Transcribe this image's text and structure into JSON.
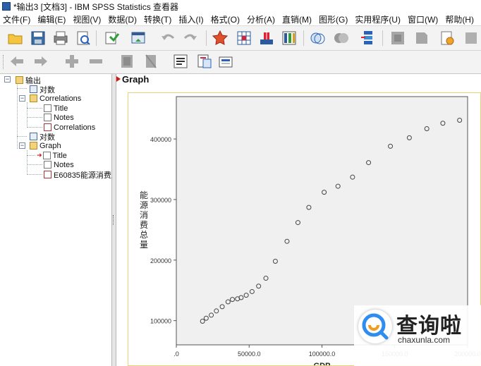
{
  "window": {
    "title": "*输出3 [文档3] - IBM SPSS Statistics 查看器"
  },
  "menu": [
    "文件(F)",
    "编辑(E)",
    "视图(V)",
    "数据(D)",
    "转换(T)",
    "插入(I)",
    "格式(O)",
    "分析(A)",
    "直销(M)",
    "图形(G)",
    "实用程序(U)",
    "窗口(W)",
    "帮助(H)"
  ],
  "toolbar_icons": [
    "open-icon",
    "save-icon",
    "print-icon",
    "print-preview-icon",
    "export-icon",
    "recall-dialog-icon",
    "undo-icon",
    "redo-icon",
    "goto-data-icon",
    "goto-case-icon",
    "goto-variable-icon",
    "variables-icon",
    "select-cases-icon",
    "weight-cases-icon",
    "split-file-icon",
    "value-labels-icon",
    "use-sets-icon",
    "show-all-icon",
    "spelling-icon",
    "scripts-icon",
    "stop-icon"
  ],
  "toolbar2_icons": [
    "back-icon",
    "forward-icon",
    "expand-icon",
    "collapse-icon",
    "show-icon",
    "hide-icon",
    "insert-heading-icon",
    "insert-title-icon",
    "insert-text-icon"
  ],
  "outline": {
    "items": [
      "输出",
      "对数",
      "Correlations",
      "Title",
      "Notes",
      "Correlations",
      "对数",
      "Graph",
      "Title",
      "Notes",
      "E60835能源消费总量"
    ]
  },
  "content": {
    "heading": "Graph"
  },
  "watermark": {
    "text": "查询啦",
    "url": "chaxunla.com"
  },
  "chart_data": {
    "type": "scatter",
    "xlabel": "GDP",
    "ylabel": "能源消费总量",
    "xlim": [
      0,
      200000
    ],
    "ylim": [
      60000,
      470000
    ],
    "xticks": [
      0,
      50000,
      100000,
      150000,
      200000
    ],
    "xtick_labels": [
      ".0",
      "50000.0",
      "100000.0",
      "150000.0",
      "200000.0"
    ],
    "yticks": [
      100000,
      200000,
      300000,
      400000
    ],
    "ytick_labels": [
      "100000",
      "200000",
      "300000",
      "400000"
    ],
    "series": [
      {
        "x": [
          18000,
          20500,
          24000,
          27500,
          31500,
          35500,
          38500,
          42000,
          44500,
          48000,
          52000,
          56500,
          61500,
          68000,
          76000,
          83500,
          91000,
          101500,
          111000,
          121000,
          132000,
          147000,
          160000,
          172000,
          183000,
          194500
        ],
        "y": [
          99000,
          104000,
          109000,
          116000,
          123000,
          131000,
          135000,
          136000,
          138000,
          142000,
          148000,
          157000,
          170000,
          198000,
          231000,
          262000,
          287000,
          312000,
          322000,
          337000,
          361000,
          388000,
          402000,
          417000,
          426000,
          431000
        ]
      }
    ]
  }
}
